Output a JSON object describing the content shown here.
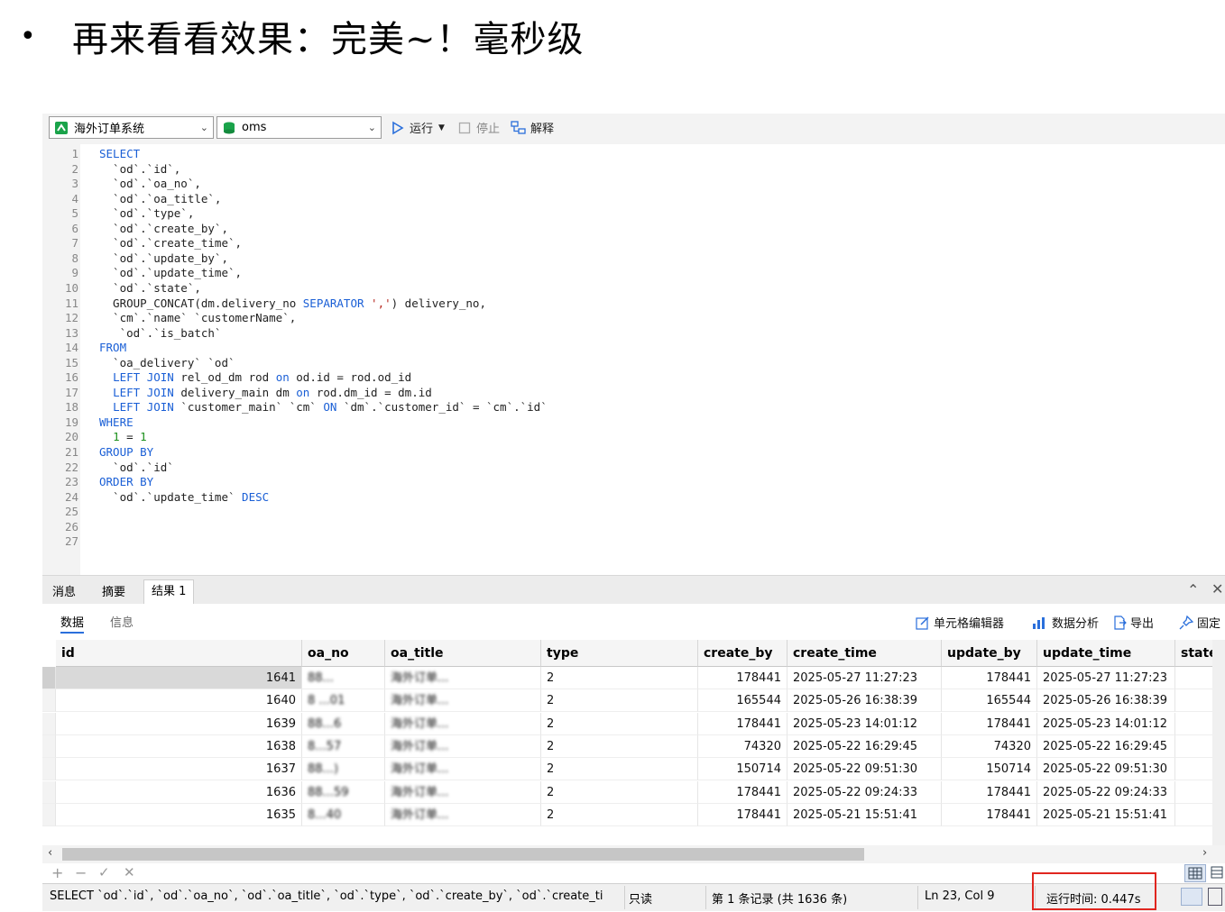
{
  "headline": {
    "bullet": "•",
    "text": "再来看看效果：完美~！毫秒级"
  },
  "toolbar": {
    "connection": "海外订单系统",
    "database": "oms",
    "run_label": "运行",
    "stop_label": "停止",
    "explain_label": "解释"
  },
  "editor": {
    "lines": [
      {
        "n": "1",
        "t": "SELECT"
      },
      {
        "n": "2",
        "t": "  `od`.`id`,"
      },
      {
        "n": "3",
        "t": "  `od`.`oa_no`,"
      },
      {
        "n": "4",
        "t": "  `od`.`oa_title`,"
      },
      {
        "n": "5",
        "t": "  `od`.`type`,"
      },
      {
        "n": "6",
        "t": "  `od`.`create_by`,"
      },
      {
        "n": "7",
        "t": "  `od`.`create_time`,"
      },
      {
        "n": "8",
        "t": "  `od`.`update_by`,"
      },
      {
        "n": "9",
        "t": "  `od`.`update_time`,"
      },
      {
        "n": "10",
        "t": "  `od`.`state`,"
      },
      {
        "n": "11",
        "t": "  GROUP_CONCAT(dm.delivery_no SEPARATOR ',') delivery_no,"
      },
      {
        "n": "12",
        "t": "  `cm`.`name` `customerName`,"
      },
      {
        "n": "13",
        "t": "   `od`.`is_batch`"
      },
      {
        "n": "14",
        "t": "FROM"
      },
      {
        "n": "15",
        "t": "  `oa_delivery` `od`"
      },
      {
        "n": "16",
        "t": "  LEFT JOIN rel_od_dm rod on od.id = rod.od_id"
      },
      {
        "n": "17",
        "t": "  LEFT JOIN delivery_main dm on rod.dm_id = dm.id"
      },
      {
        "n": "18",
        "t": "  LEFT JOIN `customer_main` `cm` ON `dm`.`customer_id` = `cm`.`id`"
      },
      {
        "n": "19",
        "t": "WHERE"
      },
      {
        "n": "20",
        "t": "  1 = 1"
      },
      {
        "n": "21",
        "t": "GROUP BY"
      },
      {
        "n": "22",
        "t": "  `od`.`id`"
      },
      {
        "n": "23",
        "t": "ORDER BY"
      },
      {
        "n": "24",
        "t": "  `od`.`update_time` DESC"
      },
      {
        "n": "25",
        "t": ""
      },
      {
        "n": "26",
        "t": ""
      },
      {
        "n": "27",
        "t": ""
      }
    ]
  },
  "result_tabs": [
    "消息",
    "摘要",
    "结果 1"
  ],
  "sub_tabs": [
    "数据",
    "信息"
  ],
  "actions": {
    "cell_editor": "单元格编辑器",
    "analysis": "数据分析",
    "export": "导出",
    "pin": "固定"
  },
  "table": {
    "columns": [
      "id",
      "oa_no",
      "oa_title",
      "type",
      "create_by",
      "create_time",
      "update_by",
      "update_time",
      "state"
    ],
    "rows": [
      {
        "id": "1641",
        "oa_no": "88...",
        "oa_title": "海外订单...",
        "type": "2",
        "create_by": "178441",
        "create_time": "2025-05-27 11:27:23",
        "update_by": "178441",
        "update_time": "2025-05-27 11:27:23"
      },
      {
        "id": "1640",
        "oa_no": "8 ...01",
        "oa_title": "海外订单...",
        "type": "2",
        "create_by": "165544",
        "create_time": "2025-05-26 16:38:39",
        "update_by": "165544",
        "update_time": "2025-05-26 16:38:39"
      },
      {
        "id": "1639",
        "oa_no": "88...6",
        "oa_title": "海外订单...",
        "type": "2",
        "create_by": "178441",
        "create_time": "2025-05-23 14:01:12",
        "update_by": "178441",
        "update_time": "2025-05-23 14:01:12"
      },
      {
        "id": "1638",
        "oa_no": "8...57",
        "oa_title": "海外订单...",
        "type": "2",
        "create_by": "74320",
        "create_time": "2025-05-22 16:29:45",
        "update_by": "74320",
        "update_time": "2025-05-22 16:29:45"
      },
      {
        "id": "1637",
        "oa_no": "88...)",
        "oa_title": "海外订单...",
        "type": "2",
        "create_by": "150714",
        "create_time": "2025-05-22 09:51:30",
        "update_by": "150714",
        "update_time": "2025-05-22 09:51:30"
      },
      {
        "id": "1636",
        "oa_no": "88...59",
        "oa_title": "海外订单...",
        "type": "2",
        "create_by": "178441",
        "create_time": "2025-05-22 09:24:33",
        "update_by": "178441",
        "update_time": "2025-05-22 09:24:33"
      },
      {
        "id": "1635",
        "oa_no": "8...40",
        "oa_title": "海外订单...",
        "type": "2",
        "create_by": "178441",
        "create_time": "2025-05-21 15:51:41",
        "update_by": "178441",
        "update_time": "2025-05-21 15:51:41"
      }
    ]
  },
  "status": {
    "query": "SELECT  `od`.`id`,  `od`.`oa_no`,  `od`.`oa_title`,  `od`.`type`,  `od`.`create_by`,  `od`.`create_ti",
    "readonly": "只读",
    "record": "第 1 条记录 (共 1636 条)",
    "cursor": "Ln 23, Col 9",
    "runtime": "运行时间: 0.447s"
  },
  "colors": {
    "keyword": "#1a5fd6",
    "number": "#1a8f1a",
    "string": "#b5261e",
    "highlight_box": "#e0261f"
  },
  "icons": [
    "connection-icon",
    "database-icon",
    "run-icon",
    "stop-icon",
    "explain-icon",
    "cell-editor-icon",
    "analysis-icon",
    "export-icon",
    "pin-icon",
    "collapse-icon",
    "close-icon",
    "add-row-icon",
    "delete-row-icon",
    "apply-icon",
    "discard-icon",
    "grid-view-icon",
    "form-view-icon"
  ]
}
